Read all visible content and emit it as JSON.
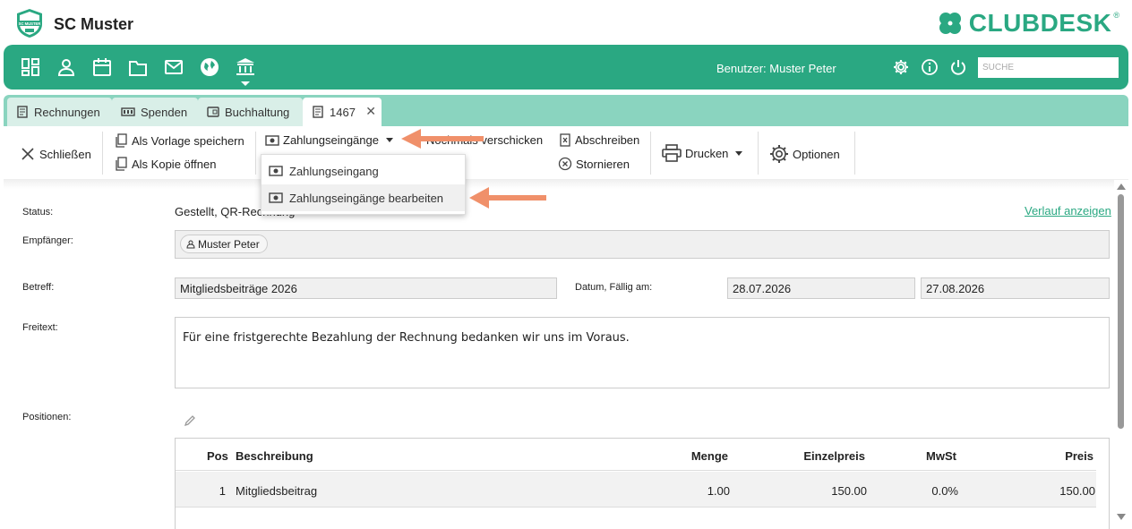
{
  "app": {
    "club_name": "SC Muster",
    "club_logo_text": "SC MUSTER",
    "brand": "CLUBDESK",
    "brand_mark": "®",
    "accent_color": "#2aa882"
  },
  "navbar": {
    "icons": [
      "dashboard-icon",
      "person-icon",
      "calendar-icon",
      "folder-icon",
      "mail-icon",
      "globe-icon",
      "bank-icon"
    ],
    "active": "bank-icon",
    "user_label": "Benutzer: Muster Peter",
    "search_placeholder": "SUCHE"
  },
  "tabs": [
    {
      "label": "Rechnungen",
      "icon": "invoice-icon"
    },
    {
      "label": "Spenden",
      "icon": "donation-icon"
    },
    {
      "label": "Buchhaltung",
      "icon": "ledger-icon"
    },
    {
      "label": "1467",
      "icon": "invoice-icon",
      "active": true
    }
  ],
  "toolbar": {
    "close": "Schließen",
    "save_template": "Als Vorlage speichern",
    "open_copy": "Als Kopie öffnen",
    "payments": "Zahlungseingänge",
    "resend": "Nochmals verschicken",
    "write_off": "Abschreiben",
    "cancel": "Stornieren",
    "print": "Drucken",
    "options": "Optionen"
  },
  "dropdown": {
    "items": [
      "Zahlungseingang",
      "Zahlungseingänge bearbeiten"
    ]
  },
  "form": {
    "status_label": "Status:",
    "status_value": "Gestellt, QR-Rechnung",
    "history_link": "Verlauf anzeigen",
    "recipient_label": "Empfänger:",
    "recipient_value": "Muster Peter",
    "subject_label": "Betreff:",
    "subject_value": "Mitgliedsbeiträge 2026",
    "date_label": "Datum, Fällig am:",
    "date_value": "28.07.2026",
    "due_value": "27.08.2026",
    "freetext_label": "Freitext:",
    "freetext_value": "Für eine fristgerechte Bezahlung der Rechnung bedanken wir uns im Voraus.",
    "positions_label": "Positionen:"
  },
  "table": {
    "columns": [
      "Pos",
      "Beschreibung",
      "Menge",
      "Einzelpreis",
      "MwSt",
      "Preis"
    ],
    "rows": [
      {
        "pos": "1",
        "description": "Mitgliedsbeitrag",
        "quantity": "1.00",
        "unit_price": "150.00",
        "vat": "0.0%",
        "price": "150.00"
      }
    ]
  }
}
